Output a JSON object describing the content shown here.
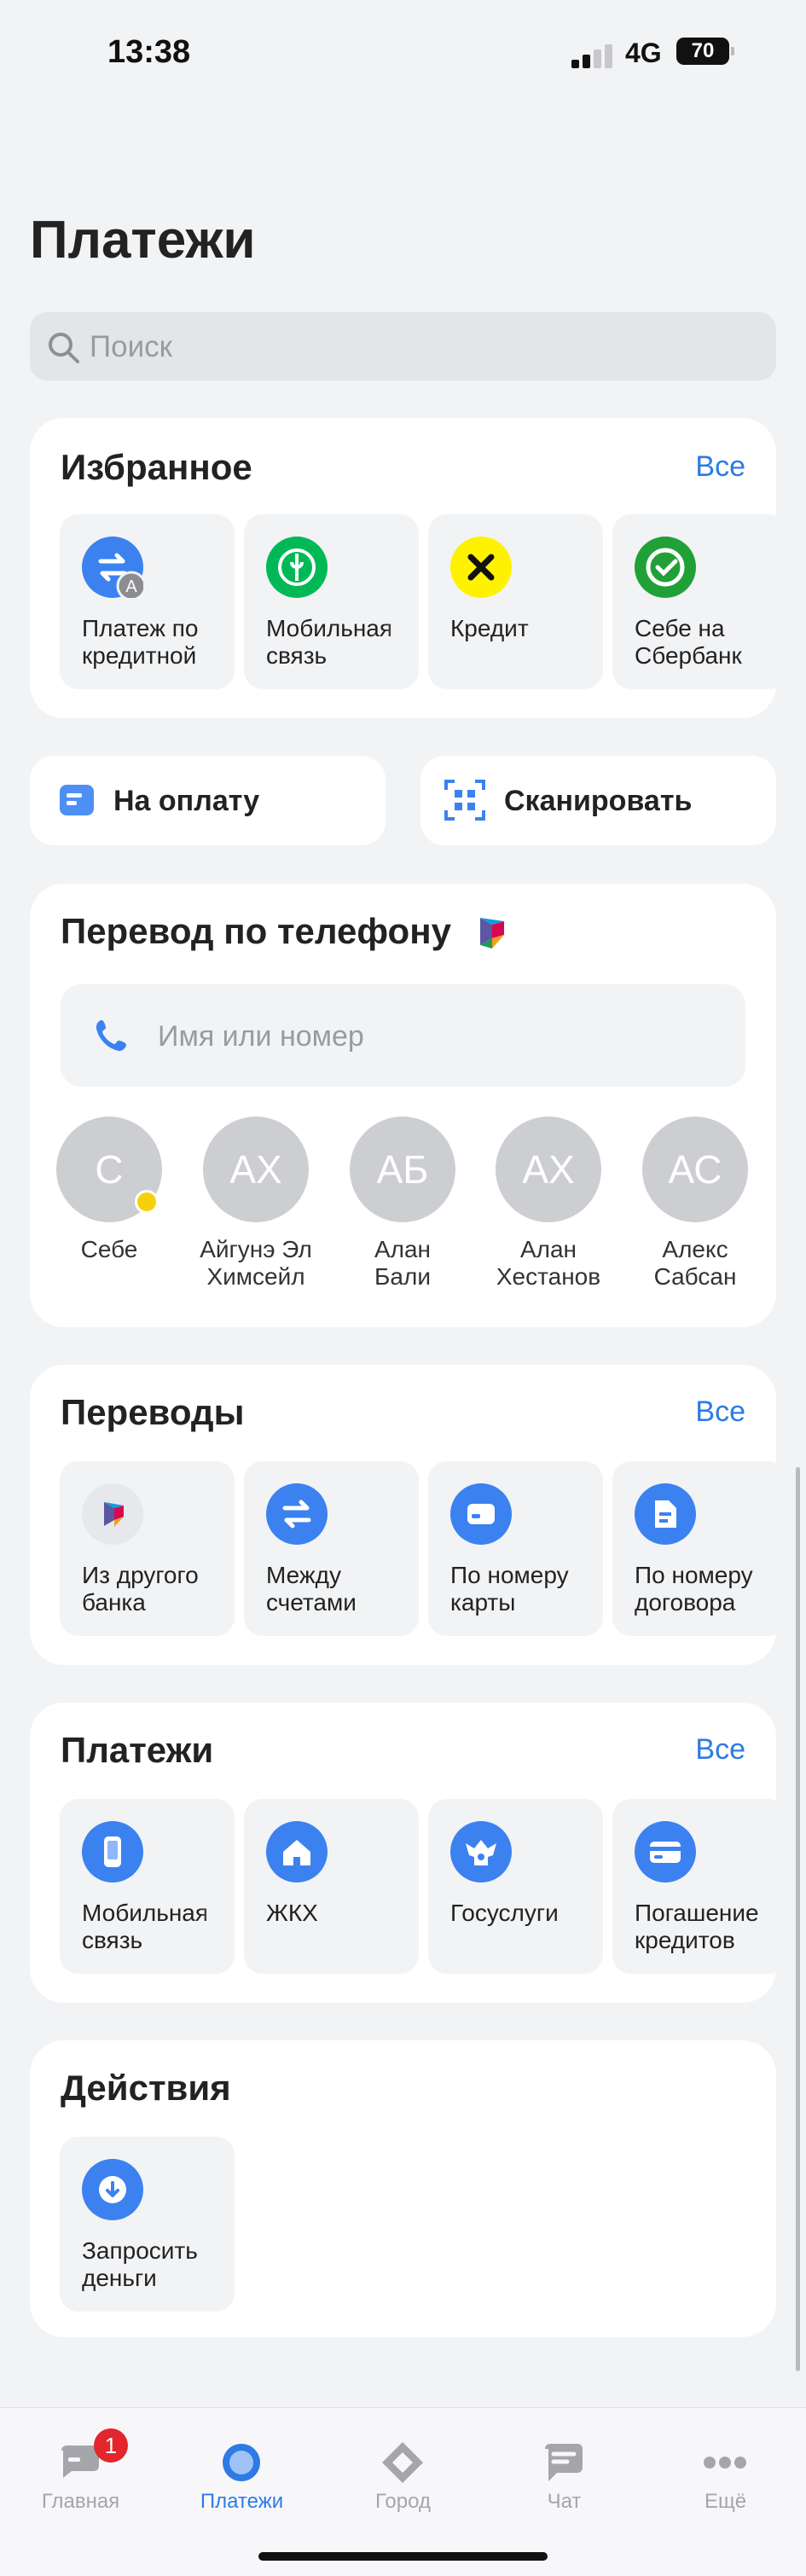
{
  "status_bar": {
    "time": "13:38",
    "network": "4G",
    "battery": "70"
  },
  "page": {
    "title": "Платежи"
  },
  "search": {
    "placeholder": "Поиск"
  },
  "favorites": {
    "title": "Избранное",
    "all_label": "Все",
    "items": [
      {
        "label": "Платеж по\nкредитной",
        "icon": "exchange-card-icon"
      },
      {
        "label": "Мобильная\nсвязь",
        "icon": "megafon-logo-icon"
      },
      {
        "label": "Кредит",
        "icon": "raiffeisen-logo-icon"
      },
      {
        "label": "Себе на\nСбербанк",
        "icon": "sber-logo-icon"
      }
    ]
  },
  "quick_actions": [
    {
      "label": "На оплату",
      "icon": "invoice-icon"
    },
    {
      "label": "Сканировать",
      "icon": "qr-scan-icon"
    }
  ],
  "phone_transfer": {
    "title": "Перевод по телефону",
    "placeholder": "Имя или номер",
    "contacts": [
      {
        "initials": "С",
        "name": "Себе"
      },
      {
        "initials": "АХ",
        "name": "Айгунэ Эл\nХимсейл"
      },
      {
        "initials": "АБ",
        "name": "Алан\nБали"
      },
      {
        "initials": "АХ",
        "name": "Алан\nХестанов"
      },
      {
        "initials": "АС",
        "name": "Алекс\nСабсан"
      }
    ]
  },
  "transfers": {
    "title": "Переводы",
    "all_label": "Все",
    "items": [
      {
        "label": "Из другого\nбанка",
        "icon": "sbp-logo-icon"
      },
      {
        "label": "Между\nсчетами",
        "icon": "exchange-icon"
      },
      {
        "label": "По номеру\nкарты",
        "icon": "card-icon"
      },
      {
        "label": "По номеру\nдоговора",
        "icon": "document-icon"
      }
    ]
  },
  "payments": {
    "title": "Платежи",
    "all_label": "Все",
    "items": [
      {
        "label": "Мобильная\nсвязь",
        "icon": "phone-device-icon"
      },
      {
        "label": "ЖКХ",
        "icon": "house-icon"
      },
      {
        "label": "Госуслуги",
        "icon": "coat-of-arms-icon"
      },
      {
        "label": "Погашение\nкредитов",
        "icon": "credit-card-icon"
      }
    ]
  },
  "actions": {
    "title": "Действия",
    "items": [
      {
        "label": "Запросить\nденьги",
        "icon": "arrow-down-circle-icon"
      }
    ]
  },
  "tabbar": {
    "items": [
      {
        "label": "Главная",
        "badge": "1"
      },
      {
        "label": "Платежи"
      },
      {
        "label": "Город"
      },
      {
        "label": "Чат"
      },
      {
        "label": "Ещё"
      }
    ]
  },
  "colors": {
    "accent": "#2d7be3",
    "tile_bg": "#f2f3f5",
    "megafon": "#00b956",
    "raiffeisen": "#fff200",
    "sber": "#21a038"
  }
}
